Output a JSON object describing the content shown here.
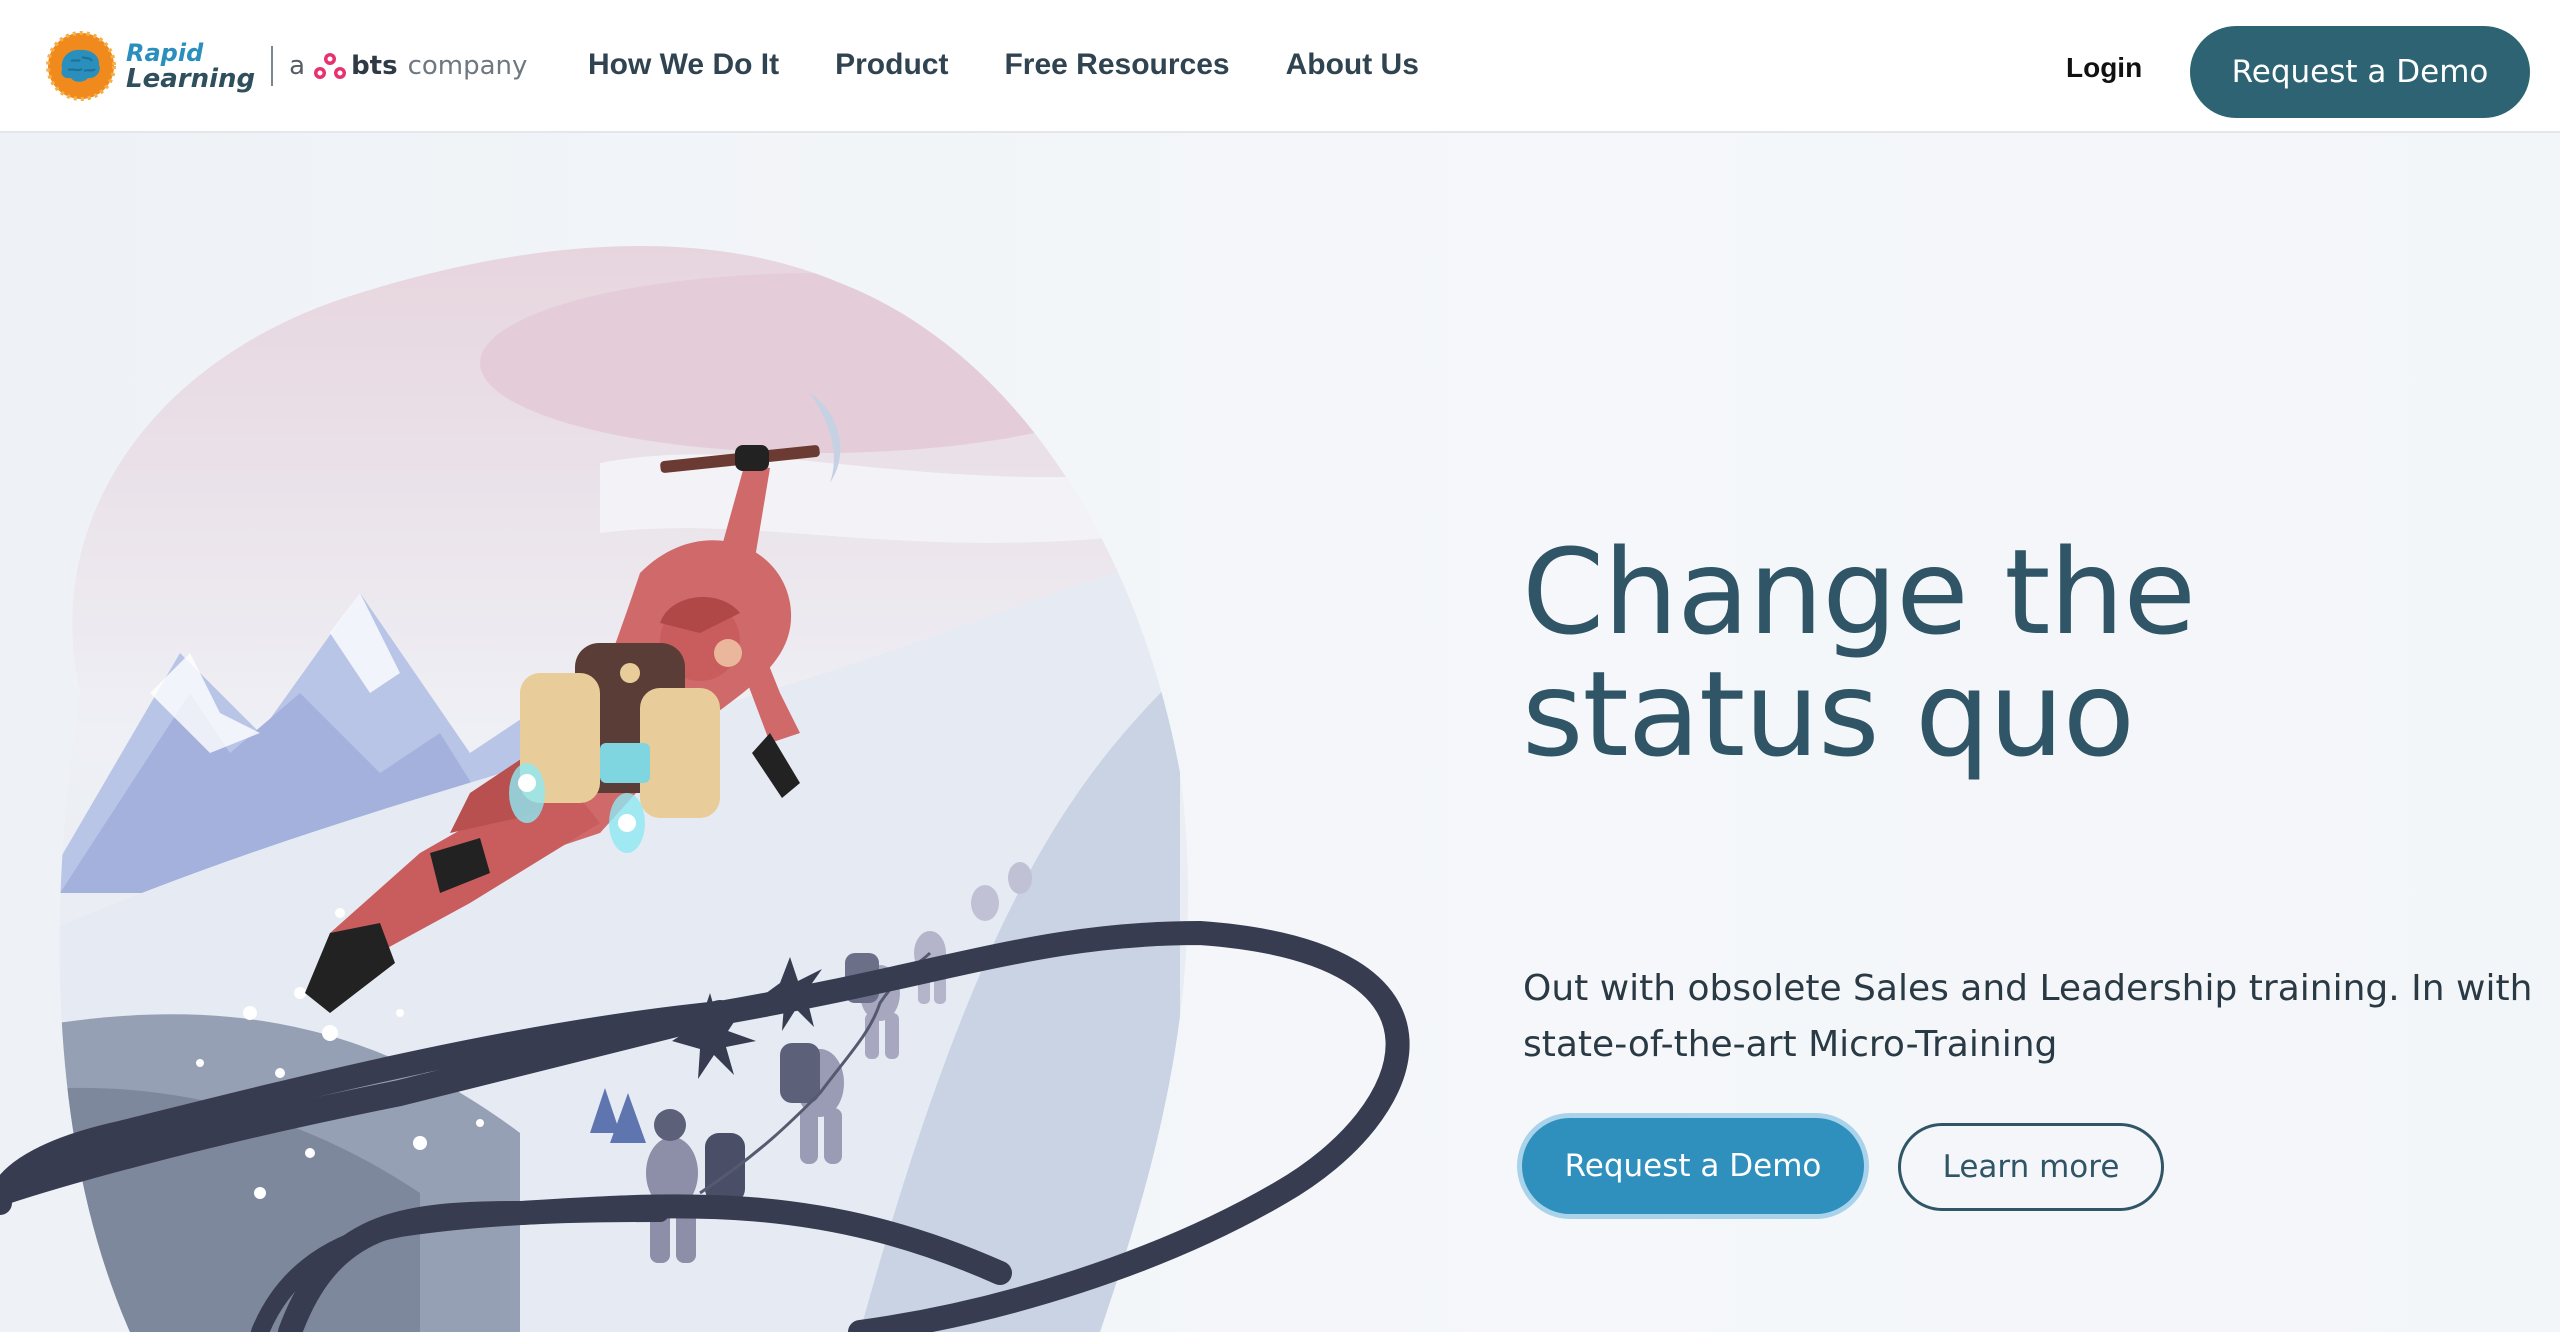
{
  "header": {
    "logo": {
      "line1": "Rapid",
      "line2": "Learning",
      "prefix": "a",
      "brand": "bts",
      "suffix": "company"
    },
    "nav": [
      {
        "label": "How We Do It"
      },
      {
        "label": "Product"
      },
      {
        "label": "Free Resources"
      },
      {
        "label": "About Us"
      }
    ],
    "login_label": "Login",
    "cta_label": "Request a Demo"
  },
  "hero": {
    "title": "Change the status quo",
    "subtitle": "Out with obsolete Sales and Leadership training. In with state-of-the-art Micro-Training",
    "primary_button": "Request a Demo",
    "secondary_button": "Learn more"
  },
  "colors": {
    "brand_dark": "#2e6374",
    "brand_blue": "#2f8fbd",
    "title": "#2f5566",
    "bts_pink": "#e6336f"
  },
  "icons": {
    "logo_mark": "rapid-learning-brain-logo",
    "bts_mark": "bts-dots-logo"
  }
}
